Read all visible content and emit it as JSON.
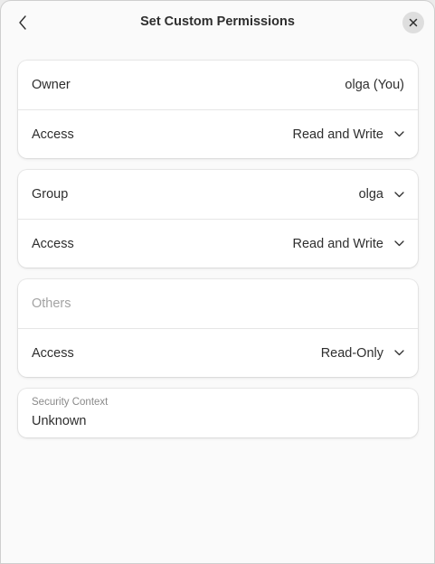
{
  "dialog": {
    "title": "Set Custom Permissions"
  },
  "owner": {
    "label": "Owner",
    "value": "olga (You)",
    "access_label": "Access",
    "access_value": "Read and Write"
  },
  "group": {
    "label": "Group",
    "value": "olga",
    "access_label": "Access",
    "access_value": "Read and Write"
  },
  "others": {
    "label": "Others",
    "access_label": "Access",
    "access_value": "Read-Only"
  },
  "security": {
    "label": "Security Context",
    "value": "Unknown"
  },
  "icons": {
    "back": "back-chevron-icon",
    "close": "close-icon",
    "dropdown": "chevron-down-icon"
  }
}
